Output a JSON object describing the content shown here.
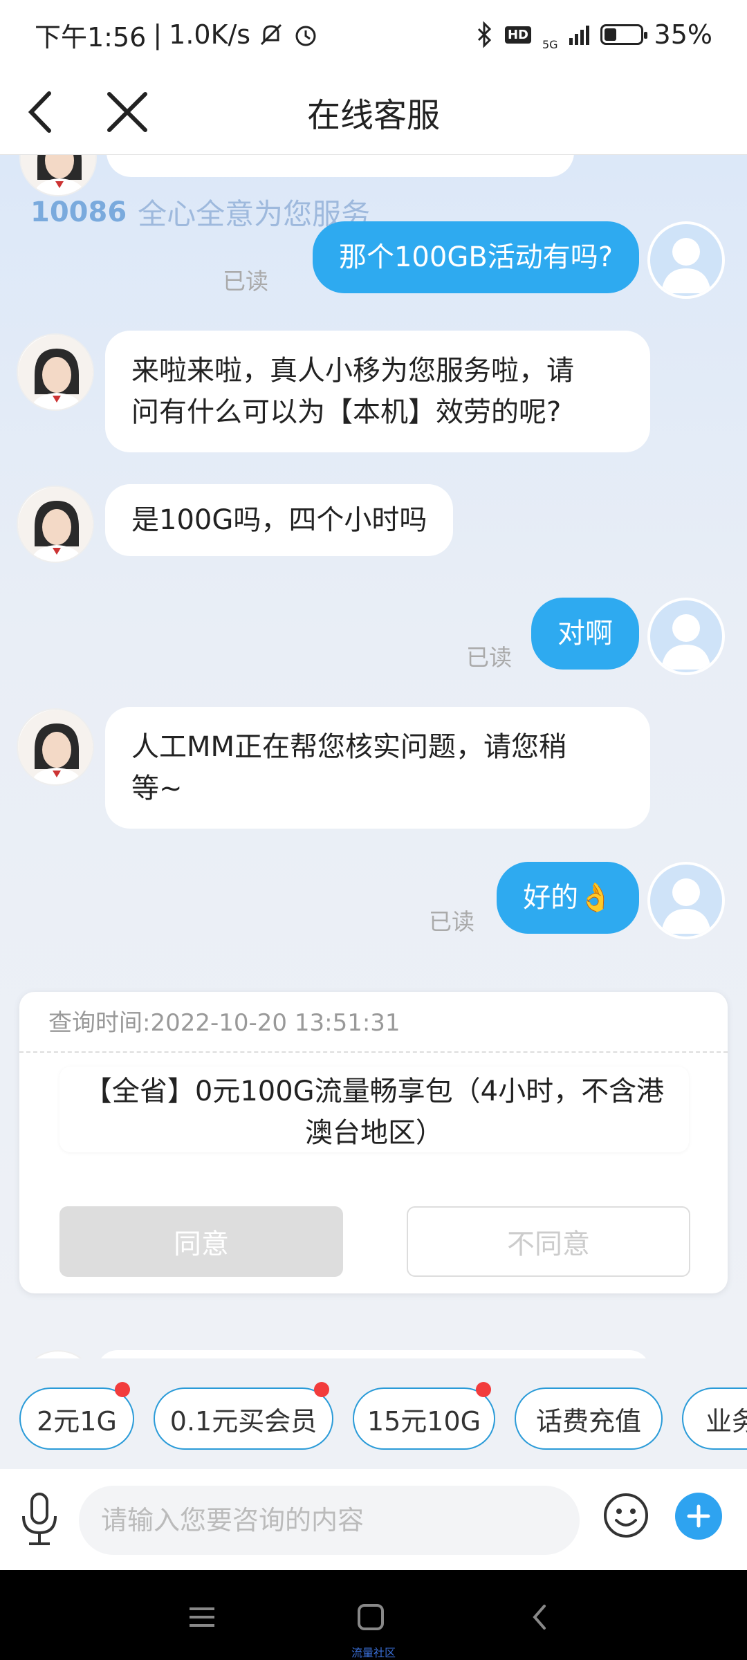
{
  "status_bar": {
    "time": "下午1:56",
    "speed": "1.0K/s",
    "network": "5G",
    "hd": "HD",
    "battery": "35%",
    "battery_level": 0.35
  },
  "nav": {
    "title": "在线客服",
    "back_icon": "chevron-left-icon",
    "close_icon": "close-icon"
  },
  "watermark": {
    "number": "10086",
    "slogan": "全心全意为您服务"
  },
  "messages": [
    {
      "from": "user",
      "text": "那个100GB活动有吗?",
      "status": "已读"
    },
    {
      "from": "agent",
      "text_line1": "来啦来啦，真人小移为您服务啦，请",
      "text_line2": "问有什么可以为【本机】效劳的呢?"
    },
    {
      "from": "agent",
      "text": "是100G吗，四个小时吗"
    },
    {
      "from": "user",
      "text": "对啊",
      "status": "已读"
    },
    {
      "from": "agent",
      "text_line1": "人工MM正在帮您核实问题，请您稍",
      "text_line2": "等~"
    },
    {
      "from": "user",
      "text": "好的👌",
      "status": "已读"
    }
  ],
  "confirm_card": {
    "query_time": "查询时间:2022-10-20 13:51:31",
    "offer_line1": "【全省】0元100G流量畅享包（4小时，不含港",
    "offer_line2": "澳台地区）",
    "agree_label": "同意",
    "disagree_label": "不同意"
  },
  "quick_chips": [
    {
      "label": "2元1G",
      "has_dot": true
    },
    {
      "label": "0.1元买会员",
      "has_dot": true
    },
    {
      "label": "15元10G",
      "has_dot": true
    },
    {
      "label": "话费充值",
      "has_dot": false
    },
    {
      "label": "业务",
      "has_dot": false
    }
  ],
  "input_bar": {
    "placeholder": "请输入您要咨询的内容",
    "mic_icon": "microphone-icon",
    "emoji_icon": "emoji-icon",
    "plus_icon": "plus-icon"
  },
  "system_nav": {
    "label": "流量社区"
  },
  "colors": {
    "accent": "#2eaaf0",
    "chip_border": "#2a9bd8",
    "badge": "#f23c3c"
  }
}
